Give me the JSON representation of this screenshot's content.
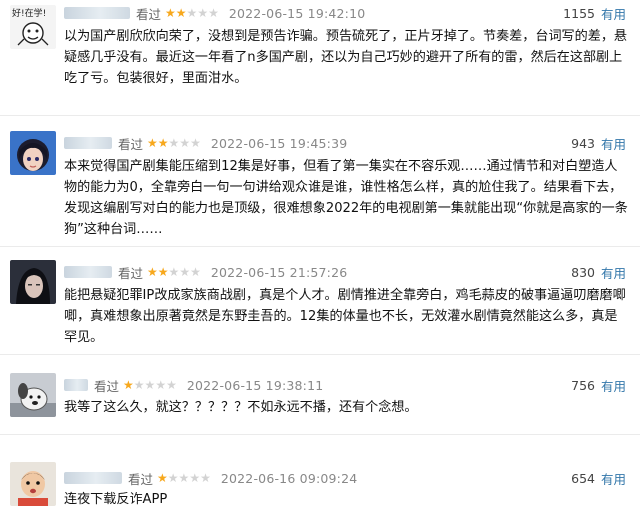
{
  "labels": {
    "watched": "看过",
    "useful": "有用"
  },
  "colors": {
    "star_on": "#f7a81d",
    "star_off": "#d3d3d3",
    "link": "#3377aa"
  },
  "reviews": [
    {
      "avatar_icon": "cartoon-avatar-icon",
      "rating": 2,
      "date": "2022-06-15 19:42:10",
      "votes": "1155",
      "content": "以为国产剧欣欣向荣了，没想到是预告诈骗。预告硫死了，正片牙掉了。节奏差，台词写的差，悬疑感几乎没有。最近这一年看了n多国产剧，还以为自己巧妙的避开了所有的雷，然后在这部剧上吃了亏。包装很好，里面泔水。"
    },
    {
      "avatar_icon": "anime-girl-avatar-icon",
      "rating": 2,
      "date": "2022-06-15 19:45:39",
      "votes": "943",
      "content": "本来觉得国产剧集能压缩到12集是好事，但看了第一集实在不容乐观……通过情节和对白塑造人物的能力为0，全靠旁白一句一句讲给观众谁是谁，谁性格怎么样，真的尬住我了。结果看下去，发现这编剧写对白的能力也是顶级，很难想象2022年的电视剧第一集就能出现“你就是高家的一条狗”这种台词……"
    },
    {
      "avatar_icon": "dark-hair-avatar-icon",
      "rating": 2,
      "date": "2022-06-15 21:57:26",
      "votes": "830",
      "content": "能把悬疑犯罪IP改成家族商战剧，真是个人才。剧情推进全靠旁白，鸡毛蒜皮的破事逼逼叨磨磨唧唧，真难想象出原著竟然是东野圭吾的。12集的体量也不长，无效灌水剧情竟然能这么多，真是罕见。"
    },
    {
      "avatar_icon": "cartoon-dog-avatar-icon",
      "rating": 1,
      "date": "2022-06-15 19:38:11",
      "votes": "756",
      "content": "我等了这么久，就这？？？？？不如永远不播，还有个念想。"
    },
    {
      "avatar_icon": "child-avatar-icon",
      "rating": 1,
      "date": "2022-06-16 09:09:24",
      "votes": "654",
      "content": "连夜下载反诈APP"
    }
  ]
}
